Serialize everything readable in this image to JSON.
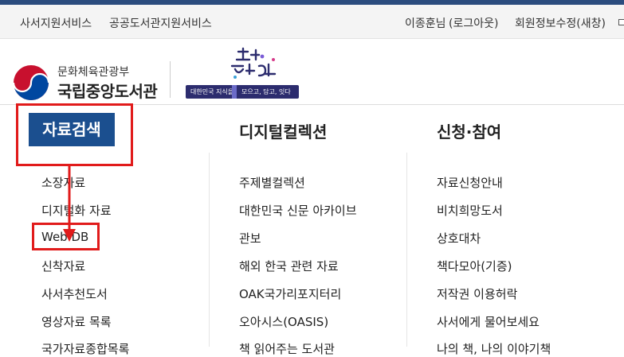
{
  "util_bar": {
    "left_links": [
      "사서지원서비스",
      "공공도서관지원서비스"
    ],
    "user_name": "이종훈님",
    "logout": "(로그아웃)",
    "edit_profile": "회원정보수정(새창)"
  },
  "header": {
    "ministry": "문화체육관광부",
    "library_name": "국립중앙도서관",
    "campaign_left": "대한민국 지식을",
    "campaign_right": "모으고, 담고, 잇다"
  },
  "nav": {
    "categories": [
      "자료검색",
      "디지털컬렉션",
      "신청·참여"
    ],
    "col1": [
      "소장자료",
      "디지털화 자료",
      "Web DB",
      "신착자료",
      "사서추천도서",
      "영상자료 목록",
      "국가자료종합목록"
    ],
    "col2": [
      "주제별컬렉션",
      "대한민국 신문 아카이브",
      "관보",
      "해외 한국 관련 자료",
      "OAK국가리포지터리",
      "오아시스(OASIS)",
      "책 읽어주는 도서관"
    ],
    "col3": [
      "자료신청안내",
      "비치희망도서",
      "상호대차",
      "책다모아(기증)",
      "저작권 이용허락",
      "사서에게 물어보세요",
      "나의 책, 나의 이야기책"
    ]
  },
  "colors": {
    "accent": "#1b4f8f",
    "highlight": "#e11b1b",
    "top_bar": "#2b4c7e"
  }
}
